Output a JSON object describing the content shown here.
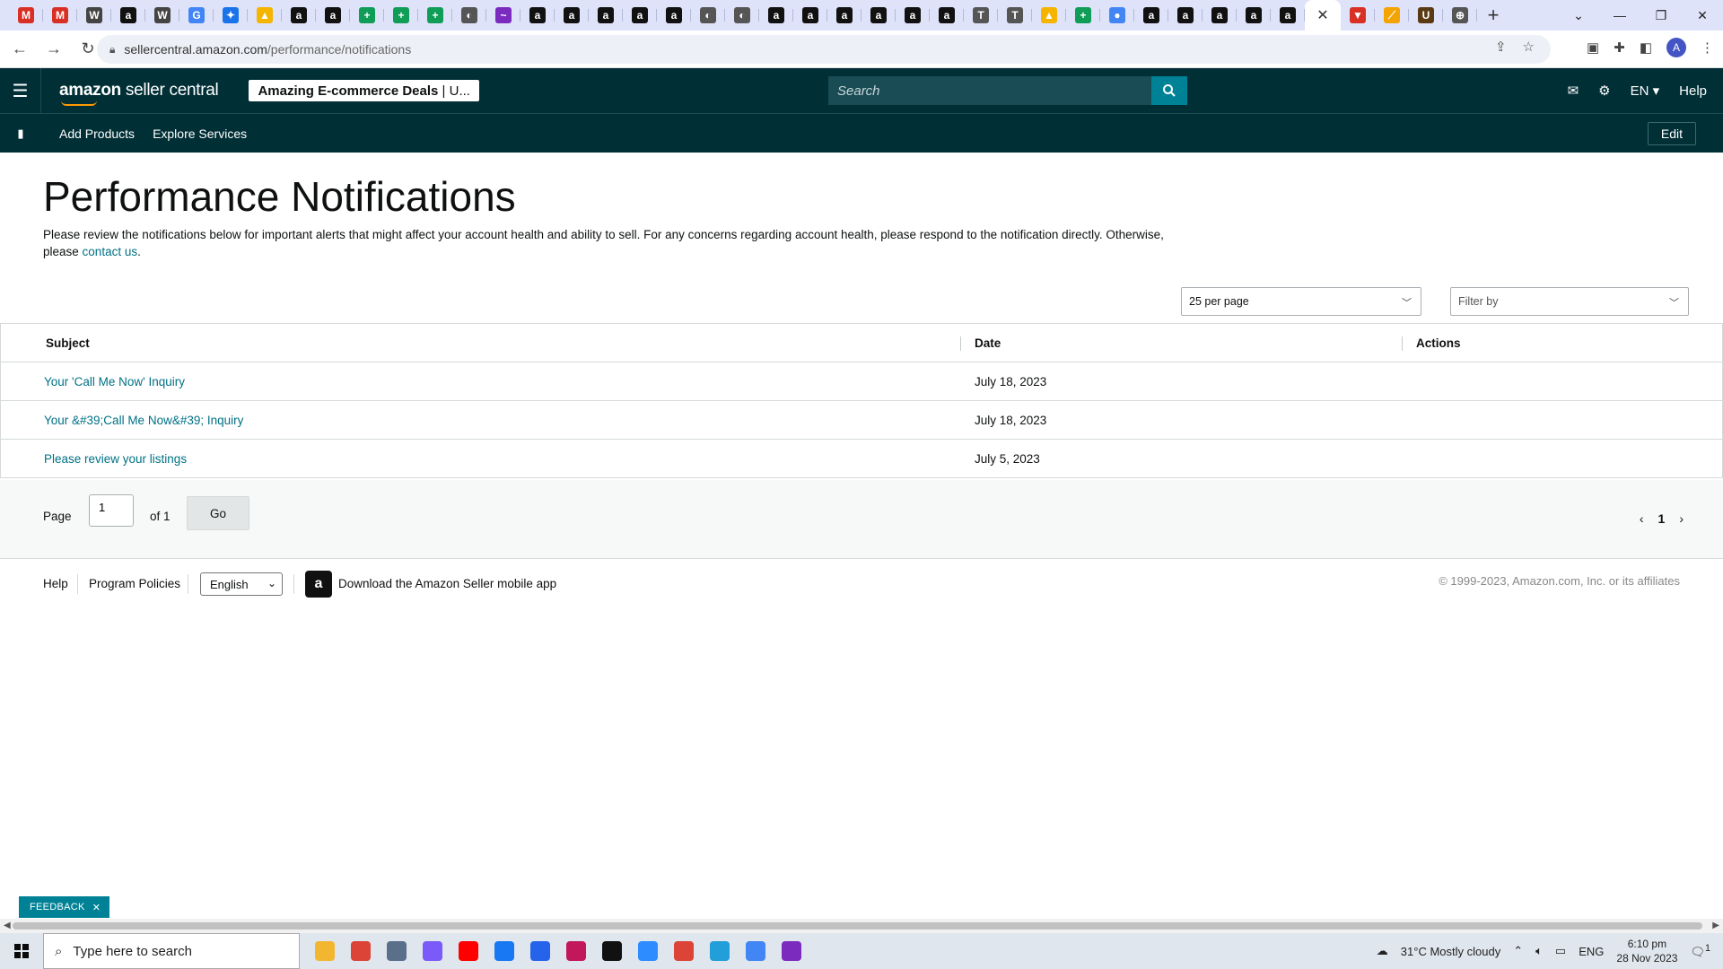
{
  "browser": {
    "tab_favicons": [
      {
        "glyph": "M",
        "color": "#d93025"
      },
      {
        "glyph": "M",
        "color": "#d93025"
      },
      {
        "glyph": "W",
        "color": "#444444"
      },
      {
        "glyph": "a",
        "color": "#111111"
      },
      {
        "glyph": "W",
        "color": "#444444"
      },
      {
        "glyph": "G",
        "color": "#4285f4"
      },
      {
        "glyph": "✦",
        "color": "#1a73e8"
      },
      {
        "glyph": "▲",
        "color": "#f4b400"
      },
      {
        "glyph": "a",
        "color": "#111111"
      },
      {
        "glyph": "a",
        "color": "#111111"
      },
      {
        "glyph": "+",
        "color": "#0f9d58"
      },
      {
        "glyph": "+",
        "color": "#0f9d58"
      },
      {
        "glyph": "+",
        "color": "#0f9d58"
      },
      {
        "glyph": "◐",
        "color": "#555555"
      },
      {
        "glyph": "~",
        "color": "#7b2cbf"
      },
      {
        "glyph": "a",
        "color": "#111111"
      },
      {
        "glyph": "a",
        "color": "#111111"
      },
      {
        "glyph": "a",
        "color": "#111111"
      },
      {
        "glyph": "a",
        "color": "#111111"
      },
      {
        "glyph": "a",
        "color": "#111111"
      },
      {
        "glyph": "◐",
        "color": "#555555"
      },
      {
        "glyph": "◐",
        "color": "#555555"
      },
      {
        "glyph": "a",
        "color": "#111111"
      },
      {
        "glyph": "a",
        "color": "#111111"
      },
      {
        "glyph": "a",
        "color": "#111111"
      },
      {
        "glyph": "a",
        "color": "#111111"
      },
      {
        "glyph": "a",
        "color": "#111111"
      },
      {
        "glyph": "a",
        "color": "#111111"
      },
      {
        "glyph": "T",
        "color": "#555555"
      },
      {
        "glyph": "T",
        "color": "#555555"
      },
      {
        "glyph": "▲",
        "color": "#f4b400"
      },
      {
        "glyph": "+",
        "color": "#0f9d58"
      },
      {
        "glyph": "●",
        "color": "#4285f4"
      },
      {
        "glyph": "a",
        "color": "#111111"
      },
      {
        "glyph": "a",
        "color": "#111111"
      },
      {
        "glyph": "a",
        "color": "#111111"
      },
      {
        "glyph": "a",
        "color": "#111111"
      },
      {
        "glyph": "a",
        "color": "#111111"
      }
    ],
    "active_tab_close": "✕",
    "trailing_favicons": [
      {
        "glyph": "▼",
        "color": "#d93025"
      },
      {
        "glyph": "⟋",
        "color": "#f4a300"
      },
      {
        "glyph": "U",
        "color": "#5a3a13"
      },
      {
        "glyph": "⊕",
        "color": "#555555"
      }
    ],
    "new_tab": "+",
    "url_host": "sellercentral.amazon.com",
    "url_path": "/performance/notifications"
  },
  "header": {
    "logo_text_bold": "amazon",
    "logo_text": " seller central",
    "store_name": "Amazing E-commerce Deals",
    "store_suffix": "U...",
    "search_placeholder": "Search",
    "language": "EN",
    "help": "Help"
  },
  "subnav": {
    "items": [
      "Add Products",
      "Explore Services"
    ],
    "edit": "Edit"
  },
  "page": {
    "title": "Performance Notifications",
    "intro": "Please review the notifications below for important alerts that might affect your account health and ability to sell. For any concerns regarding account health, please respond to the notification directly. Otherwise, please ",
    "contact_link": "contact us",
    "intro_end": "."
  },
  "controls": {
    "per_page": "25 per page",
    "filter_placeholder": "Filter by"
  },
  "table": {
    "headers": {
      "subject": "Subject",
      "date": "Date",
      "actions": "Actions"
    },
    "rows": [
      {
        "subject": "Your 'Call Me Now' Inquiry",
        "date": "July 18, 2023"
      },
      {
        "subject": "Your &#39;Call Me Now&#39; Inquiry",
        "date": "July 18, 2023"
      },
      {
        "subject": "Please review your listings",
        "date": "July 5, 2023"
      }
    ]
  },
  "pagination": {
    "page_label": "Page",
    "current_page": "1",
    "of_label": "of 1",
    "go": "Go",
    "nav_current": "1"
  },
  "footer": {
    "help": "Help",
    "policies": "Program Policies",
    "language": "English",
    "app_text": "Download the Amazon Seller mobile app",
    "copyright": "© 1999-2023, Amazon.com, Inc. or its affiliates"
  },
  "feedback": {
    "label": "FEEDBACK",
    "close": "✕"
  },
  "taskbar": {
    "search_placeholder": "Type here to search",
    "apps": [
      {
        "name": "file-explorer",
        "color": "#f2b630"
      },
      {
        "name": "chrome",
        "color": "#db4437"
      },
      {
        "name": "calculator",
        "color": "#5a6f8a"
      },
      {
        "name": "copilot",
        "color": "#7a5af8"
      },
      {
        "name": "youtube",
        "color": "#ff0000"
      },
      {
        "name": "facebook",
        "color": "#1877f2"
      },
      {
        "name": "store",
        "color": "#2563eb"
      },
      {
        "name": "snipping",
        "color": "#c2185b"
      },
      {
        "name": "sticky-notes",
        "color": "#111111"
      },
      {
        "name": "zoom",
        "color": "#2d8cff"
      },
      {
        "name": "chrome-2",
        "color": "#db4437"
      },
      {
        "name": "telegram",
        "color": "#229ed9"
      },
      {
        "name": "chrome-3",
        "color": "#4285f4"
      },
      {
        "name": "chrome-4",
        "color": "#7b2cbf"
      }
    ],
    "weather": "31°C  Mostly cloudy",
    "lang": "ENG",
    "time": "6:10 pm",
    "date": "28 Nov 2023",
    "notif_count": "1"
  }
}
